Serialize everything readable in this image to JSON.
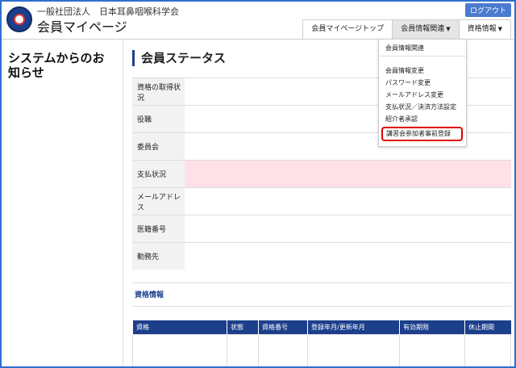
{
  "header": {
    "org_name": "一般社団法人　日本耳鼻咽喉科学会",
    "site_title": "会員マイページ",
    "logout_label": "ログアウト"
  },
  "nav": {
    "items": [
      {
        "label": "会員マイページトップ"
      },
      {
        "label": "会員情報関連"
      },
      {
        "label": "資格情報"
      }
    ]
  },
  "dropdown": {
    "header": "会員情報関連",
    "items": [
      {
        "label": "会員情報変更"
      },
      {
        "label": "パスワード変更"
      },
      {
        "label": "メールアドレス変更"
      },
      {
        "label": "支払状況／決済方法設定"
      },
      {
        "label": "紹介者承認"
      },
      {
        "label": "講習会参加者事前登録"
      }
    ]
  },
  "sidebar": {
    "title": "システムからのお知らせ"
  },
  "status": {
    "title": "会員ステータス",
    "rows": [
      {
        "label": "資格の取得状況",
        "value": ""
      },
      {
        "label": "役職",
        "value": ""
      },
      {
        "label": "委員会",
        "value": ""
      },
      {
        "label": "支払状況",
        "value": ""
      },
      {
        "label": "メールアドレス",
        "value": ""
      },
      {
        "label": "医籍番号",
        "value": ""
      },
      {
        "label": "勤務先",
        "value": ""
      }
    ]
  },
  "qualification": {
    "title": "資格情報",
    "columns": [
      "資格",
      "状態",
      "資格番号",
      "登録年月/更新年月",
      "有効期限",
      "休止期間"
    ]
  },
  "colors": {
    "brand": "#1c3f8c",
    "highlight_border": "#e00000",
    "pink_row": "#fde1e6"
  }
}
